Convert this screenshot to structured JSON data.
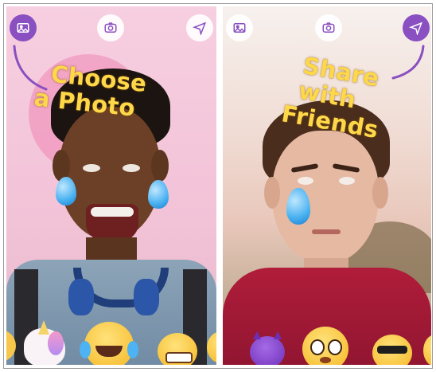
{
  "left_panel": {
    "caption_line1": "Choose",
    "caption_line2": "a Photo",
    "buttons": {
      "gallery": "gallery-icon",
      "camera": "camera-icon",
      "send": "send-icon"
    }
  },
  "right_panel": {
    "caption_line1": "Share with",
    "caption_line2": "Friends",
    "buttons": {
      "gallery": "gallery-icon",
      "camera": "camera-icon",
      "send": "send-icon"
    }
  },
  "colors": {
    "accent_purple": "#8a4fc0",
    "caption_yellow": "#ffd84a",
    "left_bg_pink": "#f3c3d8"
  },
  "emoji_tray": [
    "unicorn",
    "tears-of-joy",
    "grimacing",
    "devil",
    "pleading",
    "cool-sunglasses"
  ]
}
